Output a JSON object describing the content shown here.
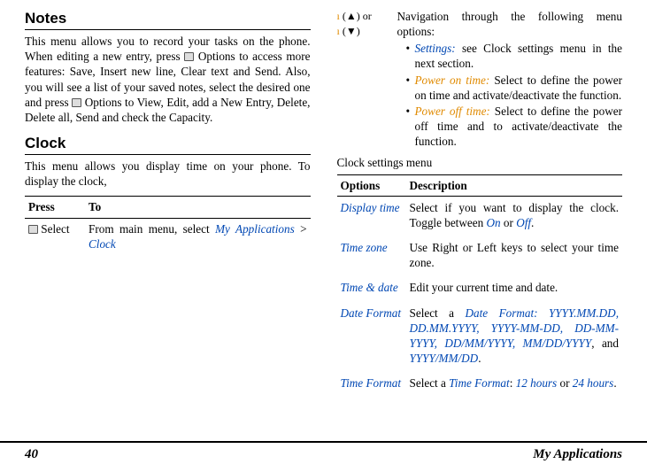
{
  "left": {
    "notes_heading": "Notes",
    "notes_body_1": "This menu allows you to record your tasks on the phone. When editing a new entry, press ",
    "notes_body_2": " Options to access more features: Save, Insert new line, Clear text and Send. Also, you will see a list of your saved notes, select the desired one and press ",
    "notes_body_3": " Options to View, Edit, add a New Entry, Delete, Delete all, Send and check the Capacity.",
    "clock_heading": "Clock",
    "clock_intro": "This menu allows you display time on your phone. To display the clock,",
    "press_header_1": "Press",
    "press_header_2": "To",
    "select_key": " Select",
    "select_desc_1": "From main menu, select ",
    "select_desc_app": "My Applica­tions",
    "select_desc_gt": " > ",
    "select_desc_clock": "Clock"
  },
  "right": {
    "nav_up": "(▲)",
    "nav_or": " or",
    "nav_down": "(▼)",
    "nav_desc": "Navigation through the following menu options:",
    "nav_b1a": "Settings:",
    "nav_b1b": " see Clock settings menu in the next section.",
    "nav_b2a": "Power on time:",
    "nav_b2b": " Select to define the power on time and activate/​deactivate the function.",
    "nav_b3a": "Power off time:",
    "nav_b3b": " Select to define the power off time and to activate/​deactivate the function.",
    "settings_sub": "Clock settings menu",
    "opt_header_1": "Options",
    "opt_header_2": "Description",
    "r1n": "Display time",
    "r1d1": "Select if you want to display the clock. Toggle between ",
    "r1d_on": "On",
    "r1d_or": " or ",
    "r1d_off": "Off",
    "r1d_end": ".",
    "r2n": "Time zone",
    "r2d": "Use Right or Left keys to select your time zone.",
    "r3n": "Time & date",
    "r3d": "Edit your current time and date.",
    "r4n": "Date Format",
    "r4d1": "Select a ",
    "r4d_fmt": "Date Format: YYYY.MM.DD, DD.MM.YYYY, YYYY-MM-DD, DD-MM-YYYY, DD/MM/YYYY, MM/DD/​YYYY",
    "r4d_and": ", and ",
    "r4d_last": "YYYY/MM/DD",
    "r4d_end": ".",
    "r5n": "Time Format",
    "r5d1": "Select a ",
    "r5d_tf": "Time Format",
    "r5d_colon": ": ",
    "r5d_12": "12 hours",
    "r5d_or": " or ",
    "r5d_24": "24 hours",
    "r5d_end": "."
  },
  "footer": {
    "page": "40",
    "section": "My Applications"
  }
}
